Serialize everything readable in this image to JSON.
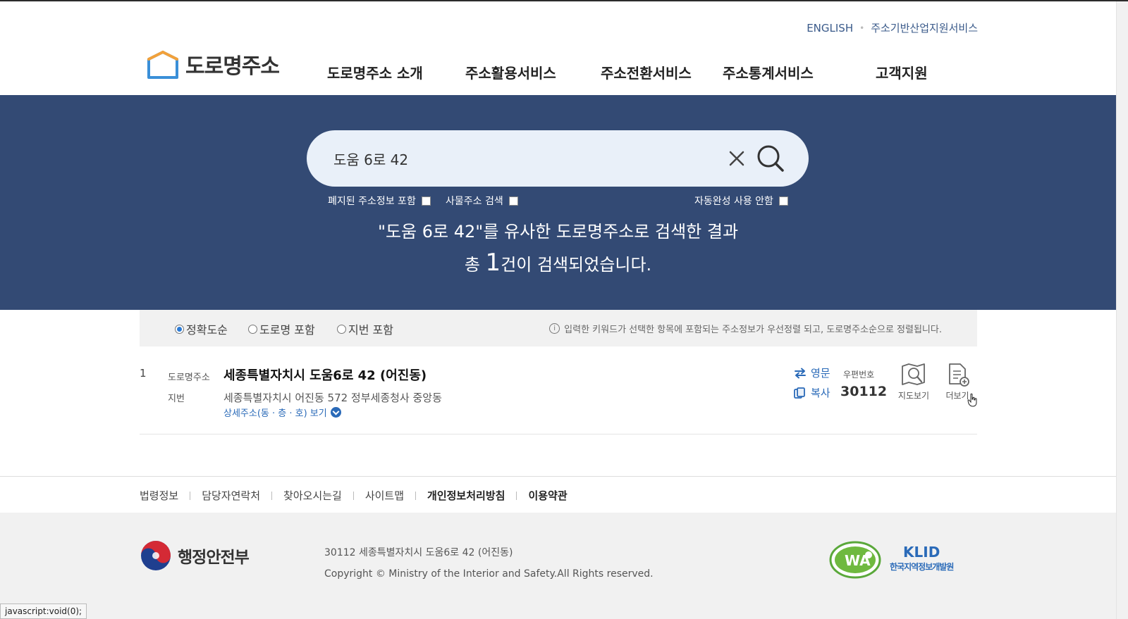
{
  "header": {
    "util_links": [
      "ENGLISH",
      "주소기반산업지원서비스"
    ],
    "logo_text": "도로명주소",
    "nav": [
      "도로명주소 소개",
      "주소활용서비스",
      "주소전환서비스",
      "주소통계서비스",
      "고객지원"
    ]
  },
  "search": {
    "value": "도움 6로 42",
    "options": {
      "abolished": "폐지된 주소정보 포함",
      "thing_address": "사물주소 검색",
      "autocomplete": "자동완성 사용 안함"
    },
    "result_line1": "\"도움 6로 42\"를 유사한 도로명주소로 검색한 결과",
    "result_prefix": "총 ",
    "result_count": "1",
    "result_suffix": "건이 검색되었습니다."
  },
  "sort": {
    "options": [
      "정확도순",
      "도로명 포함",
      "지번 포함"
    ],
    "selected": "정확도순",
    "note": "입력한 키워드가 선택한 항목에 포함되는 주소정보가 우선정렬 되고, 도로명주소순으로 정렬됩니다."
  },
  "results": [
    {
      "num": "1",
      "road_label": "도로명주소",
      "road_address": "세종특별자치시 도움6로 42 (어진동)",
      "jibun_label": "지번",
      "jibun_address": "세종특별자치시 어진동 572 정부세종청사 중앙동",
      "detail_link": "상세주소(동 · 층 · 호) 보기",
      "english_label": "영문",
      "copy_label": "복사",
      "zip_label": "우편번호",
      "zip_code": "30112",
      "map_label": "지도보기",
      "more_label": "더보기"
    }
  ],
  "footer": {
    "links": [
      "법령정보",
      "담당자연락처",
      "찾아오시는길",
      "사이트맵",
      "개인정보처리방침",
      "이용약관"
    ],
    "ministry": "행정안전부",
    "address": "30112 세종특별자치시 도움6로 42 (어진동)",
    "copyright": "Copyright © Ministry of the Interior and Safety.All Rights reserved.",
    "wa_mark": "WA",
    "klid_main": "KLID",
    "klid_sub": "한국지역정보개발원"
  },
  "status_bar": "javascript:void(0);",
  "colors": {
    "hero": "#334a74",
    "search_box": "#e9f0f9",
    "accent_blue": "#2a6ab8"
  }
}
